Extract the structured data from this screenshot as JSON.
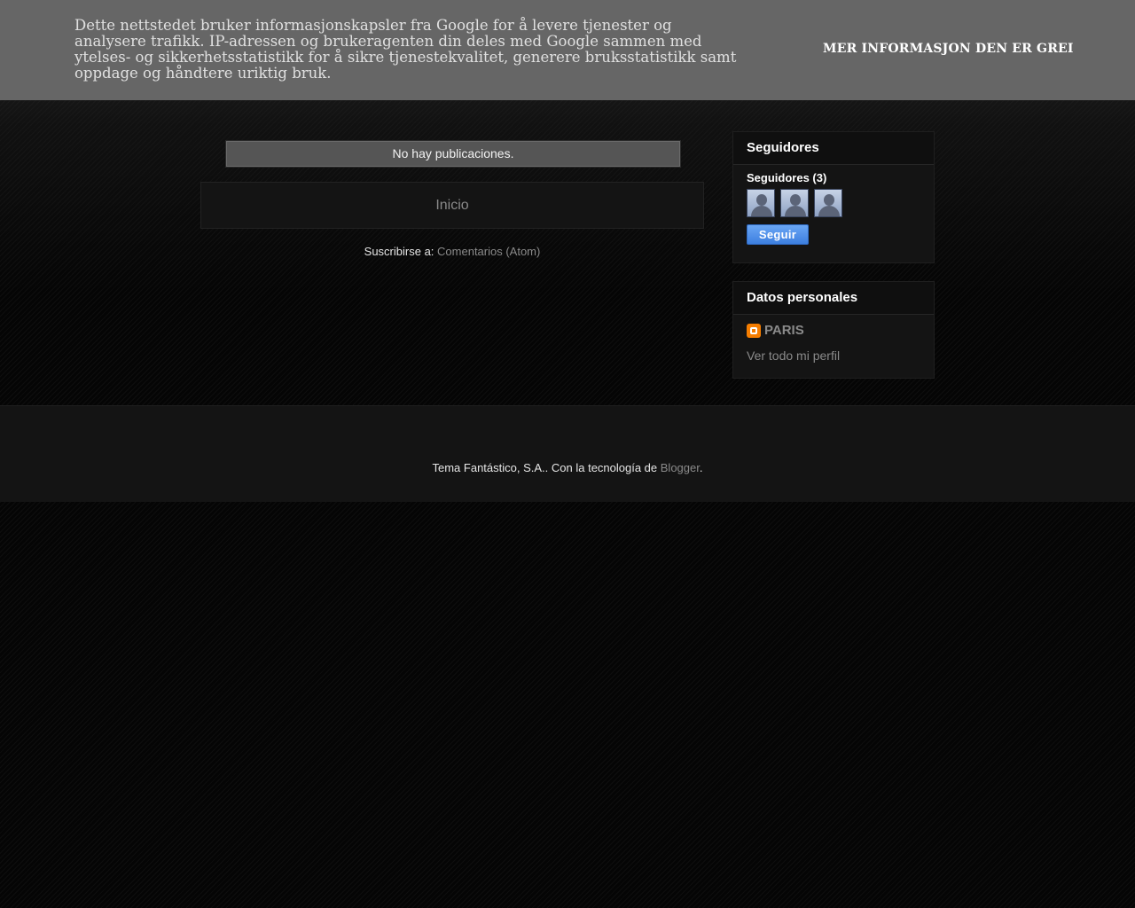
{
  "cookie_banner": {
    "text": "Dette nettstedet bruker informasjonskapsler fra Google for å levere tjenester og analysere trafikk. IP-adressen og brukeragenten din deles med Google sammen med ytelses- og sikkerhetsstatistikk for å sikre tjenestekvalitet, generere bruksstatistikk samt oppdage og håndtere uriktig bruk.",
    "more_info_label": "MER INFORMASJON",
    "ok_label": "DEN ER GREI"
  },
  "main": {
    "status_message": "No hay publicaciones.",
    "home_link": "Inicio",
    "subscribe_prefix": "Suscribirse a: ",
    "subscribe_link": "Comentarios (Atom)"
  },
  "sidebar": {
    "followers": {
      "title": "Seguidores",
      "count_label": "Seguidores (3)",
      "follow_button": "Seguir",
      "avatar_icon": "default-user-avatar-icon"
    },
    "profile": {
      "title": "Datos personales",
      "name": "PARIS",
      "view_profile": "Ver todo mi perfil",
      "icon": "blogger-icon"
    }
  },
  "footer": {
    "text_prefix": "Tema Fantástico, S.A.. Con la tecnología de ",
    "link": "Blogger",
    "text_suffix": "."
  },
  "colors": {
    "banner_bg": "#666666",
    "link_gray": "#8a8a8a",
    "follow_blue": "#4a8ae8",
    "blogger_orange": "#f57d00"
  }
}
